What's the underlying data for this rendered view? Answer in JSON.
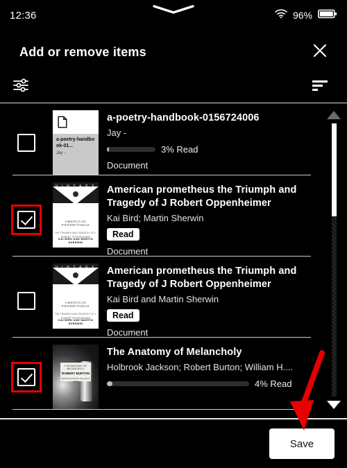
{
  "status_bar": {
    "time": "12:36",
    "battery_percent": "96%",
    "wifi_icon": "wifi-icon",
    "battery_icon": "battery-icon",
    "pull_handle_icon": "chevron-down-handle-icon"
  },
  "header": {
    "title": "Add or remove items",
    "close_icon": "close-icon"
  },
  "toolbar": {
    "filter_icon": "filter-sliders-icon",
    "sort_icon": "sort-lines-icon"
  },
  "scrollbar": {
    "up_icon": "scroll-up-arrow-icon",
    "down_icon": "scroll-down-arrow-icon"
  },
  "bottom_bar": {
    "save_label": "Save"
  },
  "annotation": {
    "arrow_color": "#e60000",
    "highlight_color": "#e60000"
  },
  "items": [
    {
      "checked": false,
      "highlighted": false,
      "title": "a-poetry-handbook-0156724006",
      "author": "Jay -",
      "progress_text": "3% Read",
      "progress_percent": 3,
      "progress_bar_width": 70,
      "type": "Document",
      "badge": null,
      "thumb_kind": "document",
      "thumb_title": "a-poetry-handbook-01...",
      "thumb_author": "Jay -"
    },
    {
      "checked": true,
      "highlighted": true,
      "title": "American prometheus the Triumph and Tragedy of J Robert Oppenheimer",
      "author": "Kai Bird; Martin Sherwin",
      "progress_text": null,
      "progress_percent": null,
      "progress_bar_width": 0,
      "type": "Document",
      "badge": "Read",
      "thumb_kind": "vintage",
      "cover_brand": "V I N T A G E",
      "cover_line1": "AMERICAN PROMETHEUS",
      "cover_line2": "THE TRIUMPH AND TRAGEDY OF J. ROBERT OPPENHEIMER",
      "cover_footer": "KAI BIRD AND MARTIN SHERWIN"
    },
    {
      "checked": false,
      "highlighted": false,
      "title": "American prometheus the Triumph and Tragedy of J Robert Oppenheimer",
      "author": "Kai Bird and Martin Sherwin",
      "progress_text": null,
      "progress_percent": null,
      "progress_bar_width": 0,
      "type": "Document",
      "badge": "Read",
      "thumb_kind": "vintage",
      "cover_brand": "V I N T A G E",
      "cover_line1": "AMERICAN PROMETHEUS",
      "cover_line2": "THE TRIUMPH AND TRAGEDY OF J. ROBERT OPPENHEIMER",
      "cover_footer": "KAI BIRD AND MARTIN SHERWIN"
    },
    {
      "checked": true,
      "highlighted": true,
      "title": "The Anatomy of Melancholy",
      "author": "Holbrook Jackson; Robert Burton; William H....",
      "progress_text": "4% Read",
      "progress_percent": 4,
      "progress_bar_width": 205,
      "type": null,
      "badge": null,
      "thumb_kind": "photo",
      "cover_line1": "THE ANATOMY OF MELANCHOLY",
      "cover_line2": "ROBERT BURTON",
      "cover_line3": "INTRODUCTION BY WILLIAM H. GASS"
    }
  ]
}
